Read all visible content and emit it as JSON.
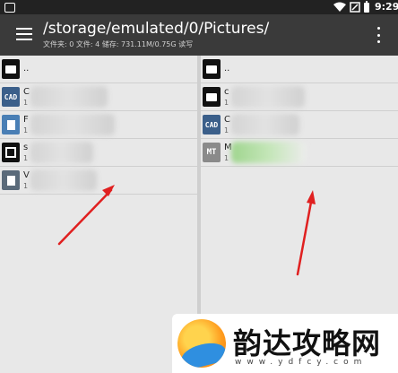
{
  "status_bar": {
    "time": "9:29",
    "icons": [
      "app-icon",
      "wifi-icon",
      "signal-icon",
      "battery-icon"
    ]
  },
  "toolbar": {
    "menu_icon": "hamburger-menu-icon",
    "path": "/storage/emulated/0/Pictures/",
    "info": "文件夹: 0  文件: 4  储存: 731.11M/0.75G  读写",
    "overflow_icon": "vertical-dots-icon"
  },
  "left_pane": {
    "items": [
      {
        "icon": "folder-up-icon",
        "name": "..",
        "sub": ""
      },
      {
        "icon": "cad-file-icon",
        "name": "C",
        "sub": "1"
      },
      {
        "icon": "document-icon",
        "name": "F",
        "sub": "1"
      },
      {
        "icon": "chip-icon",
        "name": "s",
        "sub": "1"
      },
      {
        "icon": "document-icon",
        "name": "V",
        "sub": "1"
      }
    ]
  },
  "right_pane": {
    "items": [
      {
        "icon": "folder-up-icon",
        "name": "..",
        "sub": ""
      },
      {
        "icon": "folder-icon",
        "name": "c",
        "sub": "1"
      },
      {
        "icon": "cad-file-icon",
        "name": "C",
        "sub": "1"
      },
      {
        "icon": "mt-manager-icon",
        "name": "M",
        "sub": "1"
      }
    ]
  },
  "watermark": {
    "title": "韵达攻略网",
    "url": "www.ydfcy.com"
  },
  "colors": {
    "toolbar_bg": "#3a3a3a",
    "status_bg": "#222222",
    "pane_bg": "#e8e8e8",
    "arrow": "#e02020"
  }
}
